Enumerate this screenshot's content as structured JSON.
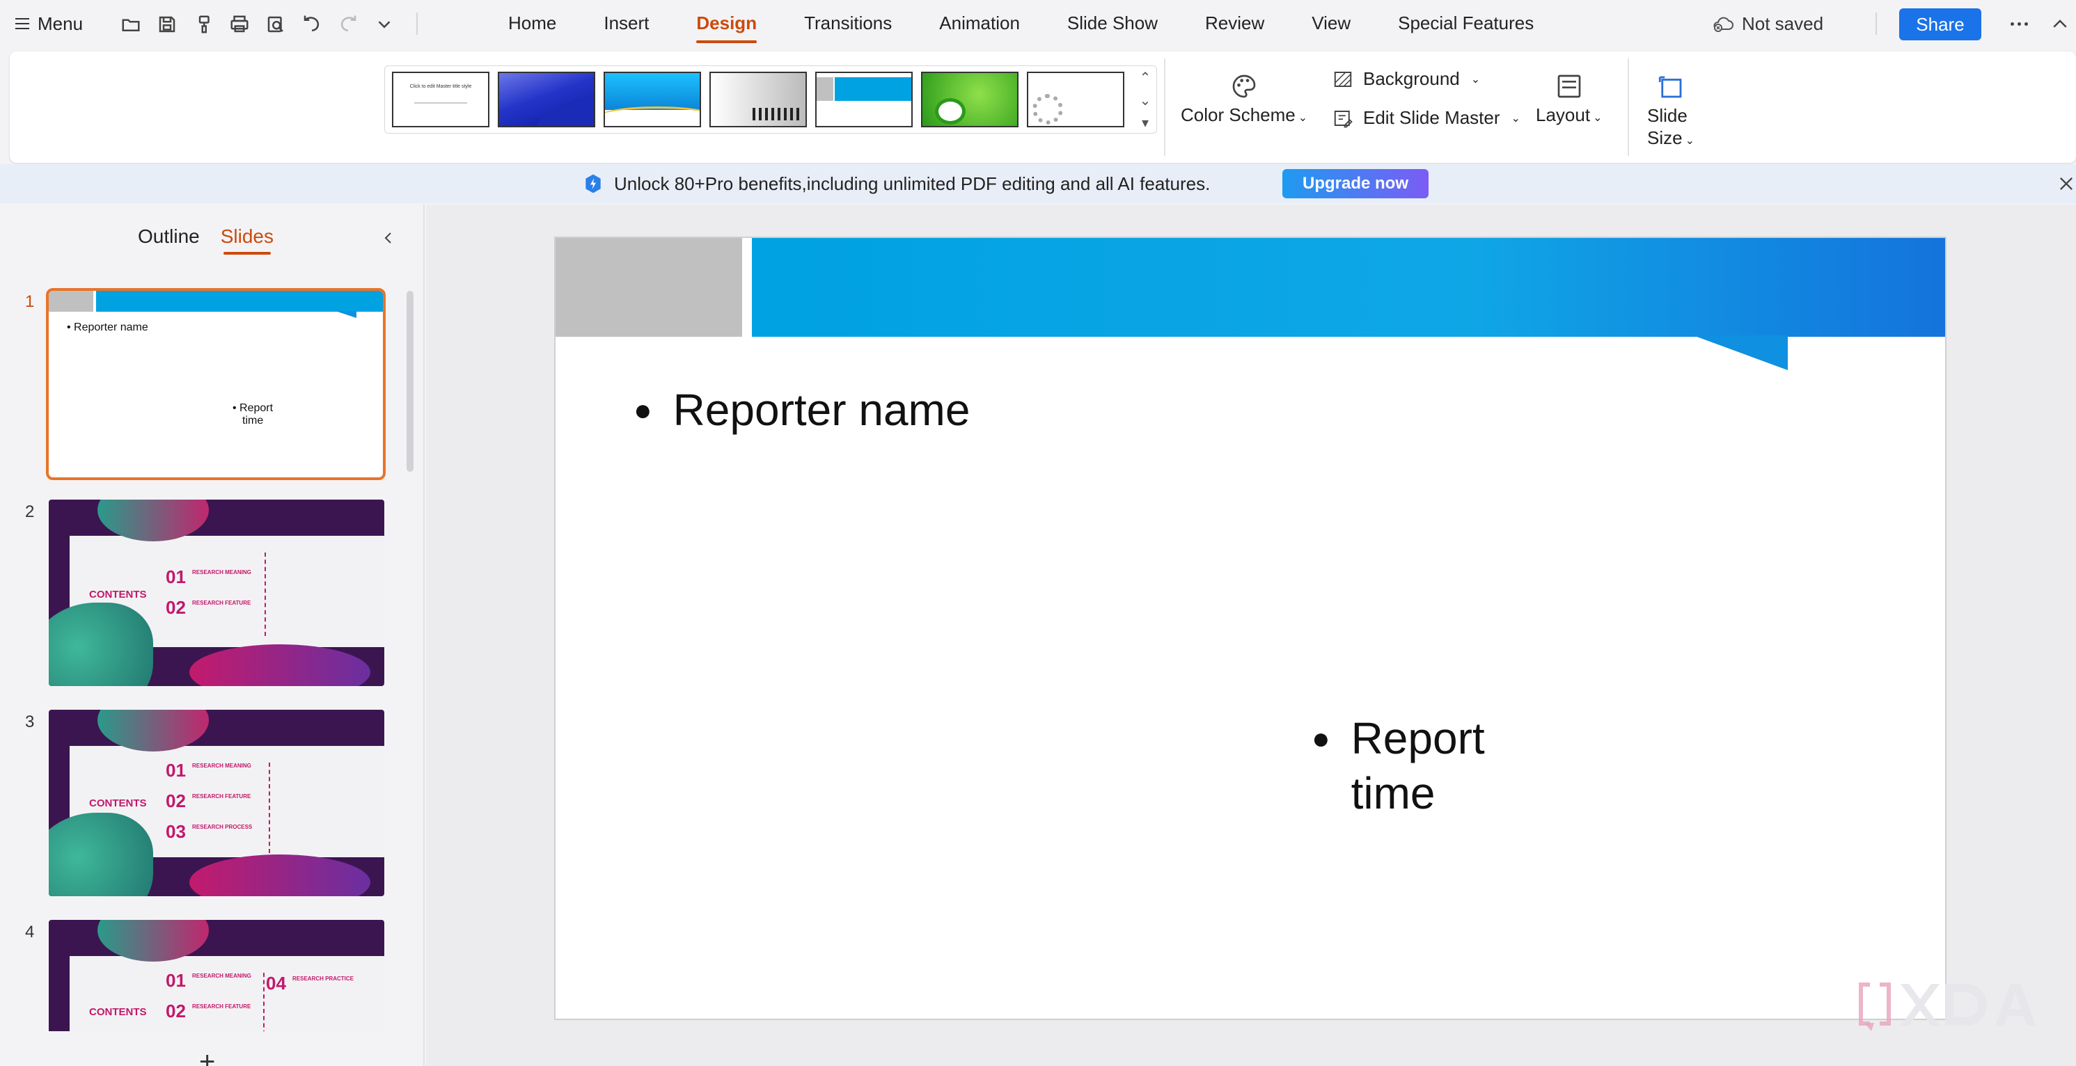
{
  "menubar": {
    "menu_label": "Menu",
    "tabs": [
      {
        "label": "Home",
        "active": false
      },
      {
        "label": "Insert",
        "active": false
      },
      {
        "label": "Design",
        "active": true
      },
      {
        "label": "Transitions",
        "active": false
      },
      {
        "label": "Animation",
        "active": false
      },
      {
        "label": "Slide Show",
        "active": false
      },
      {
        "label": "Review",
        "active": false
      },
      {
        "label": "View",
        "active": false
      },
      {
        "label": "Special Features",
        "active": false
      }
    ],
    "save_status": "Not saved",
    "share_label": "Share"
  },
  "ribbon": {
    "color_scheme_label": "Color Scheme",
    "background_label": "Background",
    "edit_master_label": "Edit Slide Master",
    "layout_label": "Layout",
    "slide_size_line1": "Slide",
    "slide_size_line2": "Size",
    "gallery_first_thumb_text": "Click to edit Master title style"
  },
  "promo": {
    "text": "Unlock 80+Pro benefits,including unlimited PDF editing and all AI features.",
    "button_label": "Upgrade now"
  },
  "left_panel": {
    "tabs": [
      {
        "label": "Outline",
        "active": false
      },
      {
        "label": "Slides",
        "active": true
      }
    ],
    "slides": [
      {
        "number": "1",
        "title": "Reporter name",
        "subtitle_line1": "Report",
        "subtitle_line2": "time"
      },
      {
        "number": "2",
        "contents": "CONTENTS",
        "items": [
          {
            "num": "01",
            "label": "RESEARCH MEANING"
          },
          {
            "num": "02",
            "label": "RESEARCH FEATURE"
          }
        ]
      },
      {
        "number": "3",
        "contents": "CONTENTS",
        "items": [
          {
            "num": "01",
            "label": "RESEARCH MEANING"
          },
          {
            "num": "02",
            "label": "RESEARCH FEATURE"
          },
          {
            "num": "03",
            "label": "RESEARCH PROCESS"
          }
        ]
      },
      {
        "number": "4",
        "contents": "CONTENTS",
        "items": [
          {
            "num": "01",
            "label": "RESEARCH MEANING"
          },
          {
            "num": "02",
            "label": "RESEARCH FEATURE"
          },
          {
            "num": "04",
            "label": "RESEARCH PRACTICE"
          }
        ]
      }
    ]
  },
  "slide": {
    "title": "Reporter name",
    "subtitle_line1": "Report",
    "subtitle_line2": "time"
  },
  "colors": {
    "accent": "#cc4a0c",
    "share": "#1a73e8",
    "slide_blue": "#00a2e2",
    "slide_grey": "#c0c0c0",
    "thumb_magenta": "#c2186a"
  }
}
